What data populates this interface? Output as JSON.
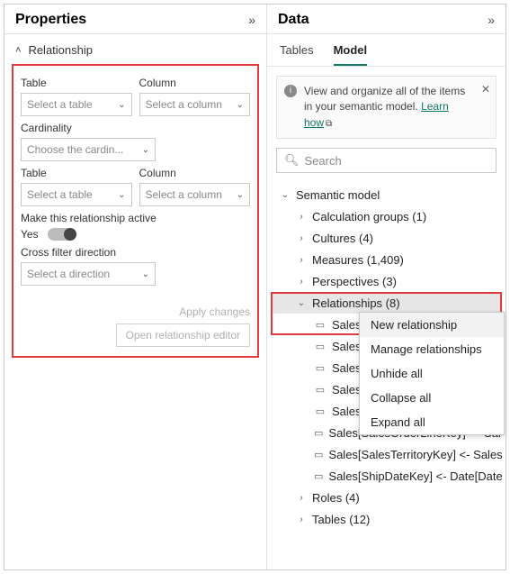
{
  "properties": {
    "title": "Properties",
    "section_label": "Relationship",
    "table_label": "Table",
    "column_label": "Column",
    "table_placeholder": "Select a table",
    "column_placeholder": "Select a column",
    "cardinality_label": "Cardinality",
    "cardinality_placeholder": "Choose the cardin...",
    "active_label": "Make this relationship active",
    "active_value": "Yes",
    "cross_label": "Cross filter direction",
    "cross_placeholder": "Select a direction",
    "apply": "Apply changes",
    "open_editor": "Open relationship editor"
  },
  "data": {
    "title": "Data",
    "tabs": {
      "tables": "Tables",
      "model": "Model"
    },
    "info": {
      "text": "View and organize all of the items in your semantic model. ",
      "link": "Learn how"
    },
    "search_placeholder": "Search",
    "tree": {
      "root": "Semantic model",
      "items": [
        "Calculation groups (1)",
        "Cultures (4)",
        "Measures (1,409)",
        "Perspectives (3)"
      ],
      "relationships_label": "Relationships (8)",
      "relationships": [
        "Sales[C",
        "Sales[D",
        "Sales[C",
        "Sales[P",
        "Sales[P",
        "Sales[SalesOrderLineKey] — Sales Or...",
        "Sales[SalesTerritoryKey] <- Sales Te...",
        "Sales[ShipDateKey] <- Date[DateKey]"
      ],
      "tail": [
        "Roles (4)",
        "Tables (12)"
      ]
    },
    "context": [
      "New relationship",
      "Manage relationships",
      "Unhide all",
      "Collapse all",
      "Expand all"
    ]
  }
}
